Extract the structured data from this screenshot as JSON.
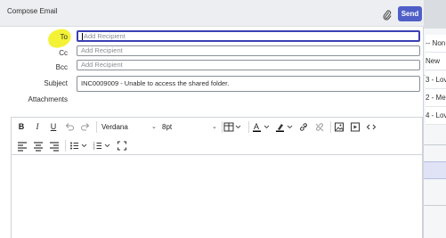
{
  "window": {
    "title": "Compose Email"
  },
  "header": {
    "send_label": "Send"
  },
  "fields": {
    "to_label": "To",
    "to_placeholder": "Add Recipient",
    "cc_label": "Cc",
    "cc_placeholder": "Add Recipient",
    "bcc_label": "Bcc",
    "bcc_placeholder": "Add Recipient",
    "subject_label": "Subject",
    "subject_value": "INC0009009 - Unable to access the shared folder.",
    "attachments_label": "Attachments"
  },
  "toolbar": {
    "bold": "B",
    "italic": "I",
    "underline": "U",
    "font_family": "Verdana",
    "font_size": "8pt"
  },
  "background_list": {
    "cells": [
      "-- Non",
      "New",
      "3 - Lov",
      "2 - Me",
      "4 - Lov"
    ]
  },
  "colors": {
    "accent": "#4f5fc7",
    "active_border": "#3b3fb4",
    "highlight": "#f3f12a"
  }
}
